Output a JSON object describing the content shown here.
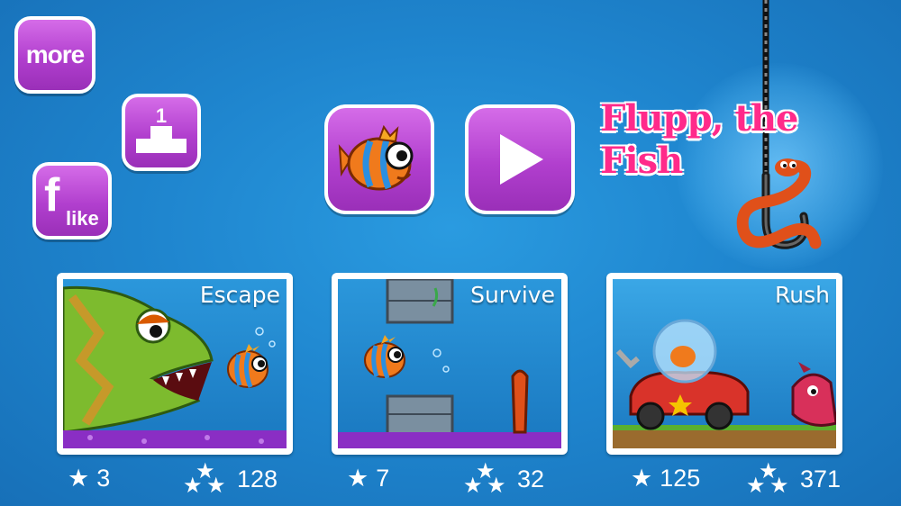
{
  "menu": {
    "more_label": "more",
    "rank_number": "1",
    "like_label": "like",
    "like_letter": "f"
  },
  "title": "Flupp, the Fish",
  "modes": [
    {
      "name": "Escape",
      "stars": "3",
      "total": "128"
    },
    {
      "name": "Survive",
      "stars": "7",
      "total": "32"
    },
    {
      "name": "Rush",
      "stars": "125",
      "total": "371"
    }
  ],
  "icons": {
    "star": "★",
    "more": "more-icon",
    "rank": "podium-icon",
    "like": "facebook-like-icon",
    "fish": "fish-character-icon",
    "play": "play-icon",
    "hook": "hook-with-worm-icon"
  },
  "colors": {
    "button_purple": "#b13fce",
    "title_pink": "#ff2a8a",
    "ocean_blue": "#1f86cf",
    "fish_orange": "#f07a1c"
  }
}
